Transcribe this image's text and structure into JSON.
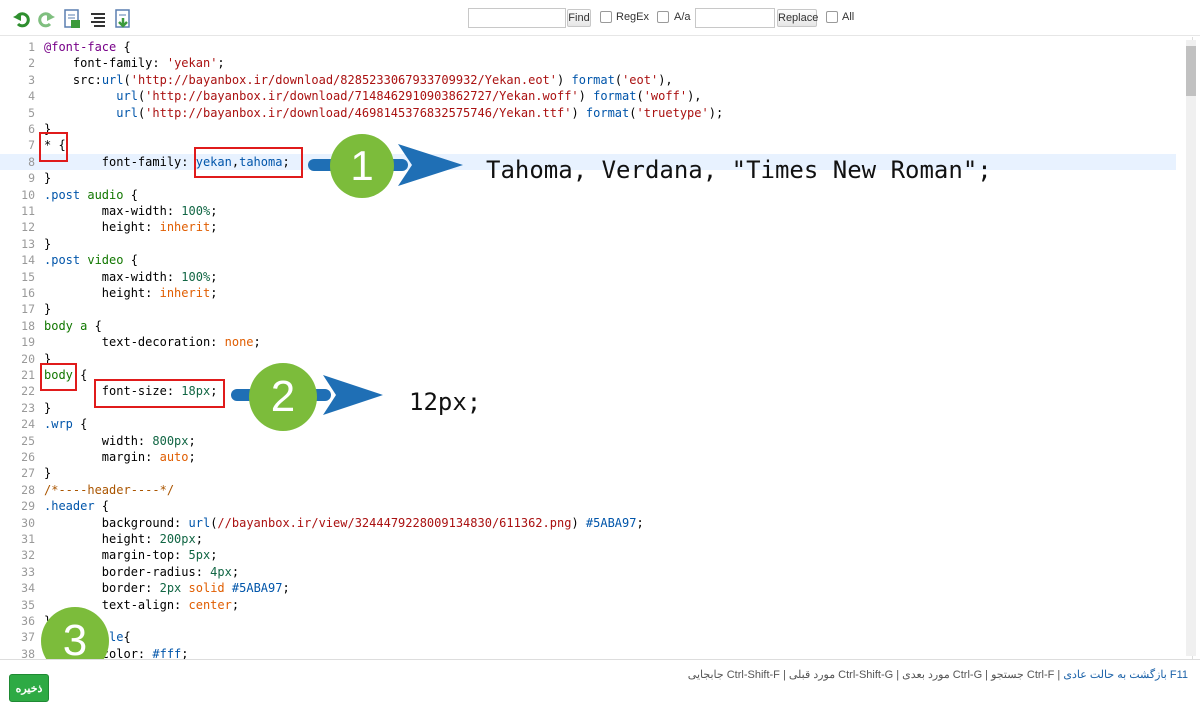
{
  "toolbar": {
    "icons": [
      "undo-icon",
      "redo-icon",
      "document-icon",
      "format-lines-icon",
      "download-icon"
    ],
    "find_placeholder": "",
    "find_label": "Find",
    "regex_label": "RegEx",
    "case_label": "A/a",
    "replace_placeholder": "",
    "replace_label": "Replace",
    "all_label": "All"
  },
  "editor": {
    "lines": [
      {
        "n": "1",
        "html": "<span class=\"t-kw\">@font-face</span> {"
      },
      {
        "n": "2",
        "html": "    <span class=\"t-prop\">font-family</span>: <span class=\"t-str\">'yekan'</span>;"
      },
      {
        "n": "3",
        "html": "    <span class=\"t-prop\">src</span>:<span class=\"t-atom\">url</span>(<span class=\"t-str\">'http://bayanbox.ir/download/8285233067933709932/Yekan.eot'</span>) <span class=\"t-atom\">format</span>(<span class=\"t-str\">'eot'</span>),"
      },
      {
        "n": "4",
        "html": "          <span class=\"t-atom\">url</span>(<span class=\"t-str\">'http://bayanbox.ir/download/7148462910903862727/Yekan.woff'</span>) <span class=\"t-atom\">format</span>(<span class=\"t-str\">'woff'</span>),"
      },
      {
        "n": "5",
        "html": "          <span class=\"t-atom\">url</span>(<span class=\"t-str\">'http://bayanbox.ir/download/4698145376832575746/Yekan.ttf'</span>) <span class=\"t-atom\">format</span>(<span class=\"t-str\">'truetype'</span>);"
      },
      {
        "n": "6",
        "html": "}"
      },
      {
        "n": "7",
        "html": "* {"
      },
      {
        "n": "8",
        "html": "        <span class=\"t-prop\">font-family</span>: <span class=\"t-atom\">yekan</span>,<span class=\"t-atom\">tahoma</span>;"
      },
      {
        "n": "9",
        "html": "}"
      },
      {
        "n": "10",
        "html": "<span class=\"t-qual\">.post</span> <span class=\"t-tag\">audio</span> {"
      },
      {
        "n": "11",
        "html": "        <span class=\"t-prop\">max-width</span>: <span class=\"t-num\">100%</span>;"
      },
      {
        "n": "12",
        "html": "        <span class=\"t-prop\">height</span>: <span class=\"t-val\">inherit</span>;"
      },
      {
        "n": "13",
        "html": "}"
      },
      {
        "n": "14",
        "html": "<span class=\"t-qual\">.post</span> <span class=\"t-tag\">video</span> {"
      },
      {
        "n": "15",
        "html": "        <span class=\"t-prop\">max-width</span>: <span class=\"t-num\">100%</span>;"
      },
      {
        "n": "16",
        "html": "        <span class=\"t-prop\">height</span>: <span class=\"t-val\">inherit</span>;"
      },
      {
        "n": "17",
        "html": "}"
      },
      {
        "n": "18",
        "html": "<span class=\"t-tag\">body</span> <span class=\"t-tag\">a</span> {"
      },
      {
        "n": "19",
        "html": "        <span class=\"t-prop\">text-decoration</span>: <span class=\"t-val\">none</span>;"
      },
      {
        "n": "20",
        "html": "}"
      },
      {
        "n": "21",
        "html": "<span class=\"t-tag\">body</span> {"
      },
      {
        "n": "22",
        "html": "        <span class=\"t-prop\">font-size</span>: <span class=\"t-num\">18px</span>;"
      },
      {
        "n": "23",
        "html": "}"
      },
      {
        "n": "24",
        "html": "<span class=\"t-qual\">.wrp</span> {"
      },
      {
        "n": "25",
        "html": "        <span class=\"t-prop\">width</span>: <span class=\"t-num\">800px</span>;"
      },
      {
        "n": "26",
        "html": "        <span class=\"t-prop\">margin</span>: <span class=\"t-val\">auto</span>;"
      },
      {
        "n": "27",
        "html": "}"
      },
      {
        "n": "28",
        "html": "<span class=\"t-com\">/*----header----*/</span>"
      },
      {
        "n": "29",
        "html": "<span class=\"t-qual\">.header</span> {"
      },
      {
        "n": "30",
        "html": "        <span class=\"t-prop\">background</span>: <span class=\"t-atom\">url</span>(<span class=\"t-str\">//bayanbox.ir/view/3244479228009134830/611362.png</span>) <span class=\"t-atom\">#5ABA97</span>;"
      },
      {
        "n": "31",
        "html": "        <span class=\"t-prop\">height</span>: <span class=\"t-num\">200px</span>;"
      },
      {
        "n": "32",
        "html": "        <span class=\"t-prop\">margin-top</span>: <span class=\"t-num\">5px</span>;"
      },
      {
        "n": "33",
        "html": "        <span class=\"t-prop\">border-radius</span>: <span class=\"t-num\">4px</span>;"
      },
      {
        "n": "34",
        "html": "        <span class=\"t-prop\">border</span>: <span class=\"t-num\">2px</span> <span class=\"t-val\">solid</span> <span class=\"t-atom\">#5ABA97</span>;"
      },
      {
        "n": "35",
        "html": "        <span class=\"t-prop\">text-align</span>: <span class=\"t-val\">center</span>;"
      },
      {
        "n": "36",
        "html": "}"
      },
      {
        "n": "37",
        "html": "<span class=\"t-qual\">.meta-title</span>{"
      },
      {
        "n": "38",
        "html": "        <span class=\"t-prop\">color</span>: <span class=\"t-atom\">#fff</span>;"
      }
    ]
  },
  "annotations": {
    "badge1": "1",
    "badge2": "2",
    "badge3": "3",
    "note1": "Tahoma, Verdana, \"Times New Roman\";",
    "note2": "12px;"
  },
  "footer": {
    "hint_link": "F11 بازگشت به حالت عادی",
    "hint_rest": " | Ctrl-F جستجو | Ctrl-G مورد بعدی | Ctrl-Shift-G مورد قبلی | Ctrl-Shift-F جابجایی",
    "save_label": "ذخیره"
  },
  "colors": {
    "badge_green": "#7cbc3b",
    "arrow_blue": "#1f6fb5",
    "highlight_red": "#e01b1b",
    "save_green": "#2eaa44"
  }
}
